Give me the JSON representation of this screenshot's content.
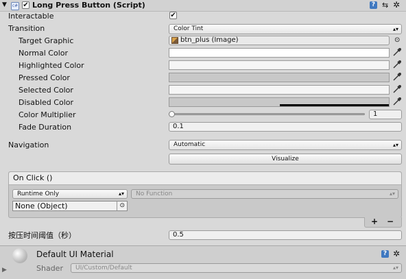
{
  "component": {
    "title": "Long Press Button (Script)",
    "enabled": true
  },
  "interactable": {
    "label": "Interactable",
    "checked": true
  },
  "transition": {
    "label": "Transition",
    "value": "Color Tint"
  },
  "target_graphic": {
    "label": "Target Graphic",
    "value": "btn_plus (Image)"
  },
  "normal_color": {
    "label": "Normal Color",
    "hex": "#ffffff"
  },
  "highlighted_color": {
    "label": "Highlighted Color",
    "hex": "#f5f5f5"
  },
  "pressed_color": {
    "label": "Pressed Color",
    "hex": "#c8c8c8"
  },
  "selected_color": {
    "label": "Selected Color",
    "hex": "#f5f5f5"
  },
  "disabled_color": {
    "label": "Disabled Color",
    "hex": "#c8c8c8"
  },
  "color_multiplier": {
    "label": "Color Multiplier",
    "value": "1",
    "slider_fraction": 0.0
  },
  "fade_duration": {
    "label": "Fade Duration",
    "value": "0.1"
  },
  "navigation": {
    "label": "Navigation",
    "value": "Automatic",
    "visualize_label": "Visualize"
  },
  "on_click": {
    "header": "On Click ()",
    "runtime": "Runtime Only",
    "function": "No Function",
    "object": "None (Object)",
    "add_label": "+",
    "remove_label": "−"
  },
  "press_threshold": {
    "label": "按压时间阈值（秒）",
    "value": "0.5"
  },
  "material": {
    "title": "Default UI Material",
    "shader_label": "Shader",
    "shader_value": "UI/Custom/Default"
  },
  "icons": [
    "foldout-arrow-icon",
    "script-icon",
    "help-icon",
    "presets-icon",
    "gear-icon",
    "eyedropper-icon",
    "object-picker-icon",
    "image-asset-icon",
    "material-icon"
  ]
}
